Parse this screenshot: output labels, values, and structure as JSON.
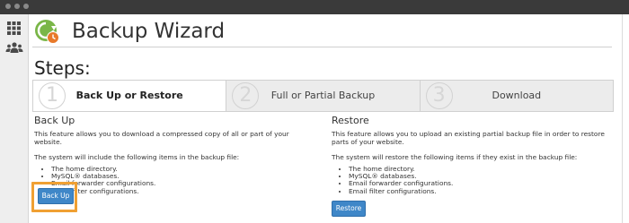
{
  "header": {
    "title": "Backup Wizard"
  },
  "steps": {
    "heading": "Steps:",
    "items": [
      {
        "number": "1",
        "label": "Back Up or Restore",
        "active": true
      },
      {
        "number": "2",
        "label": "Full or Partial Backup",
        "active": false
      },
      {
        "number": "3",
        "label": "Download",
        "active": false
      }
    ]
  },
  "backup": {
    "heading": "Back Up",
    "description": "This feature allows you to download a compressed copy of all or part of your website.",
    "includes_intro": "The system will include the following items in the backup file:",
    "items": [
      "The home directory.",
      "MySQL® databases.",
      "Email forwarder configurations.",
      "Email filter configurations."
    ],
    "button_label": "Back Up"
  },
  "restore": {
    "heading": "Restore",
    "description": "This feature allows you to upload an existing partial backup file in order to restore parts of your website.",
    "includes_intro": "The system will restore the following items if they exist in the backup file:",
    "items": [
      "The home directory.",
      "MySQL® databases.",
      "Email forwarder configurations.",
      "Email filter configurations."
    ],
    "button_label": "Restore"
  },
  "colors": {
    "titlebar": "#3a3a3a",
    "button": "#3f87c8",
    "highlight": "#f0a033",
    "logo_green": "#7ab648",
    "logo_orange": "#e8792a"
  },
  "icons": {
    "sidebar_top": "grid-icon",
    "sidebar_second": "users-icon",
    "logo": "backup-wizard-logo-icon"
  }
}
